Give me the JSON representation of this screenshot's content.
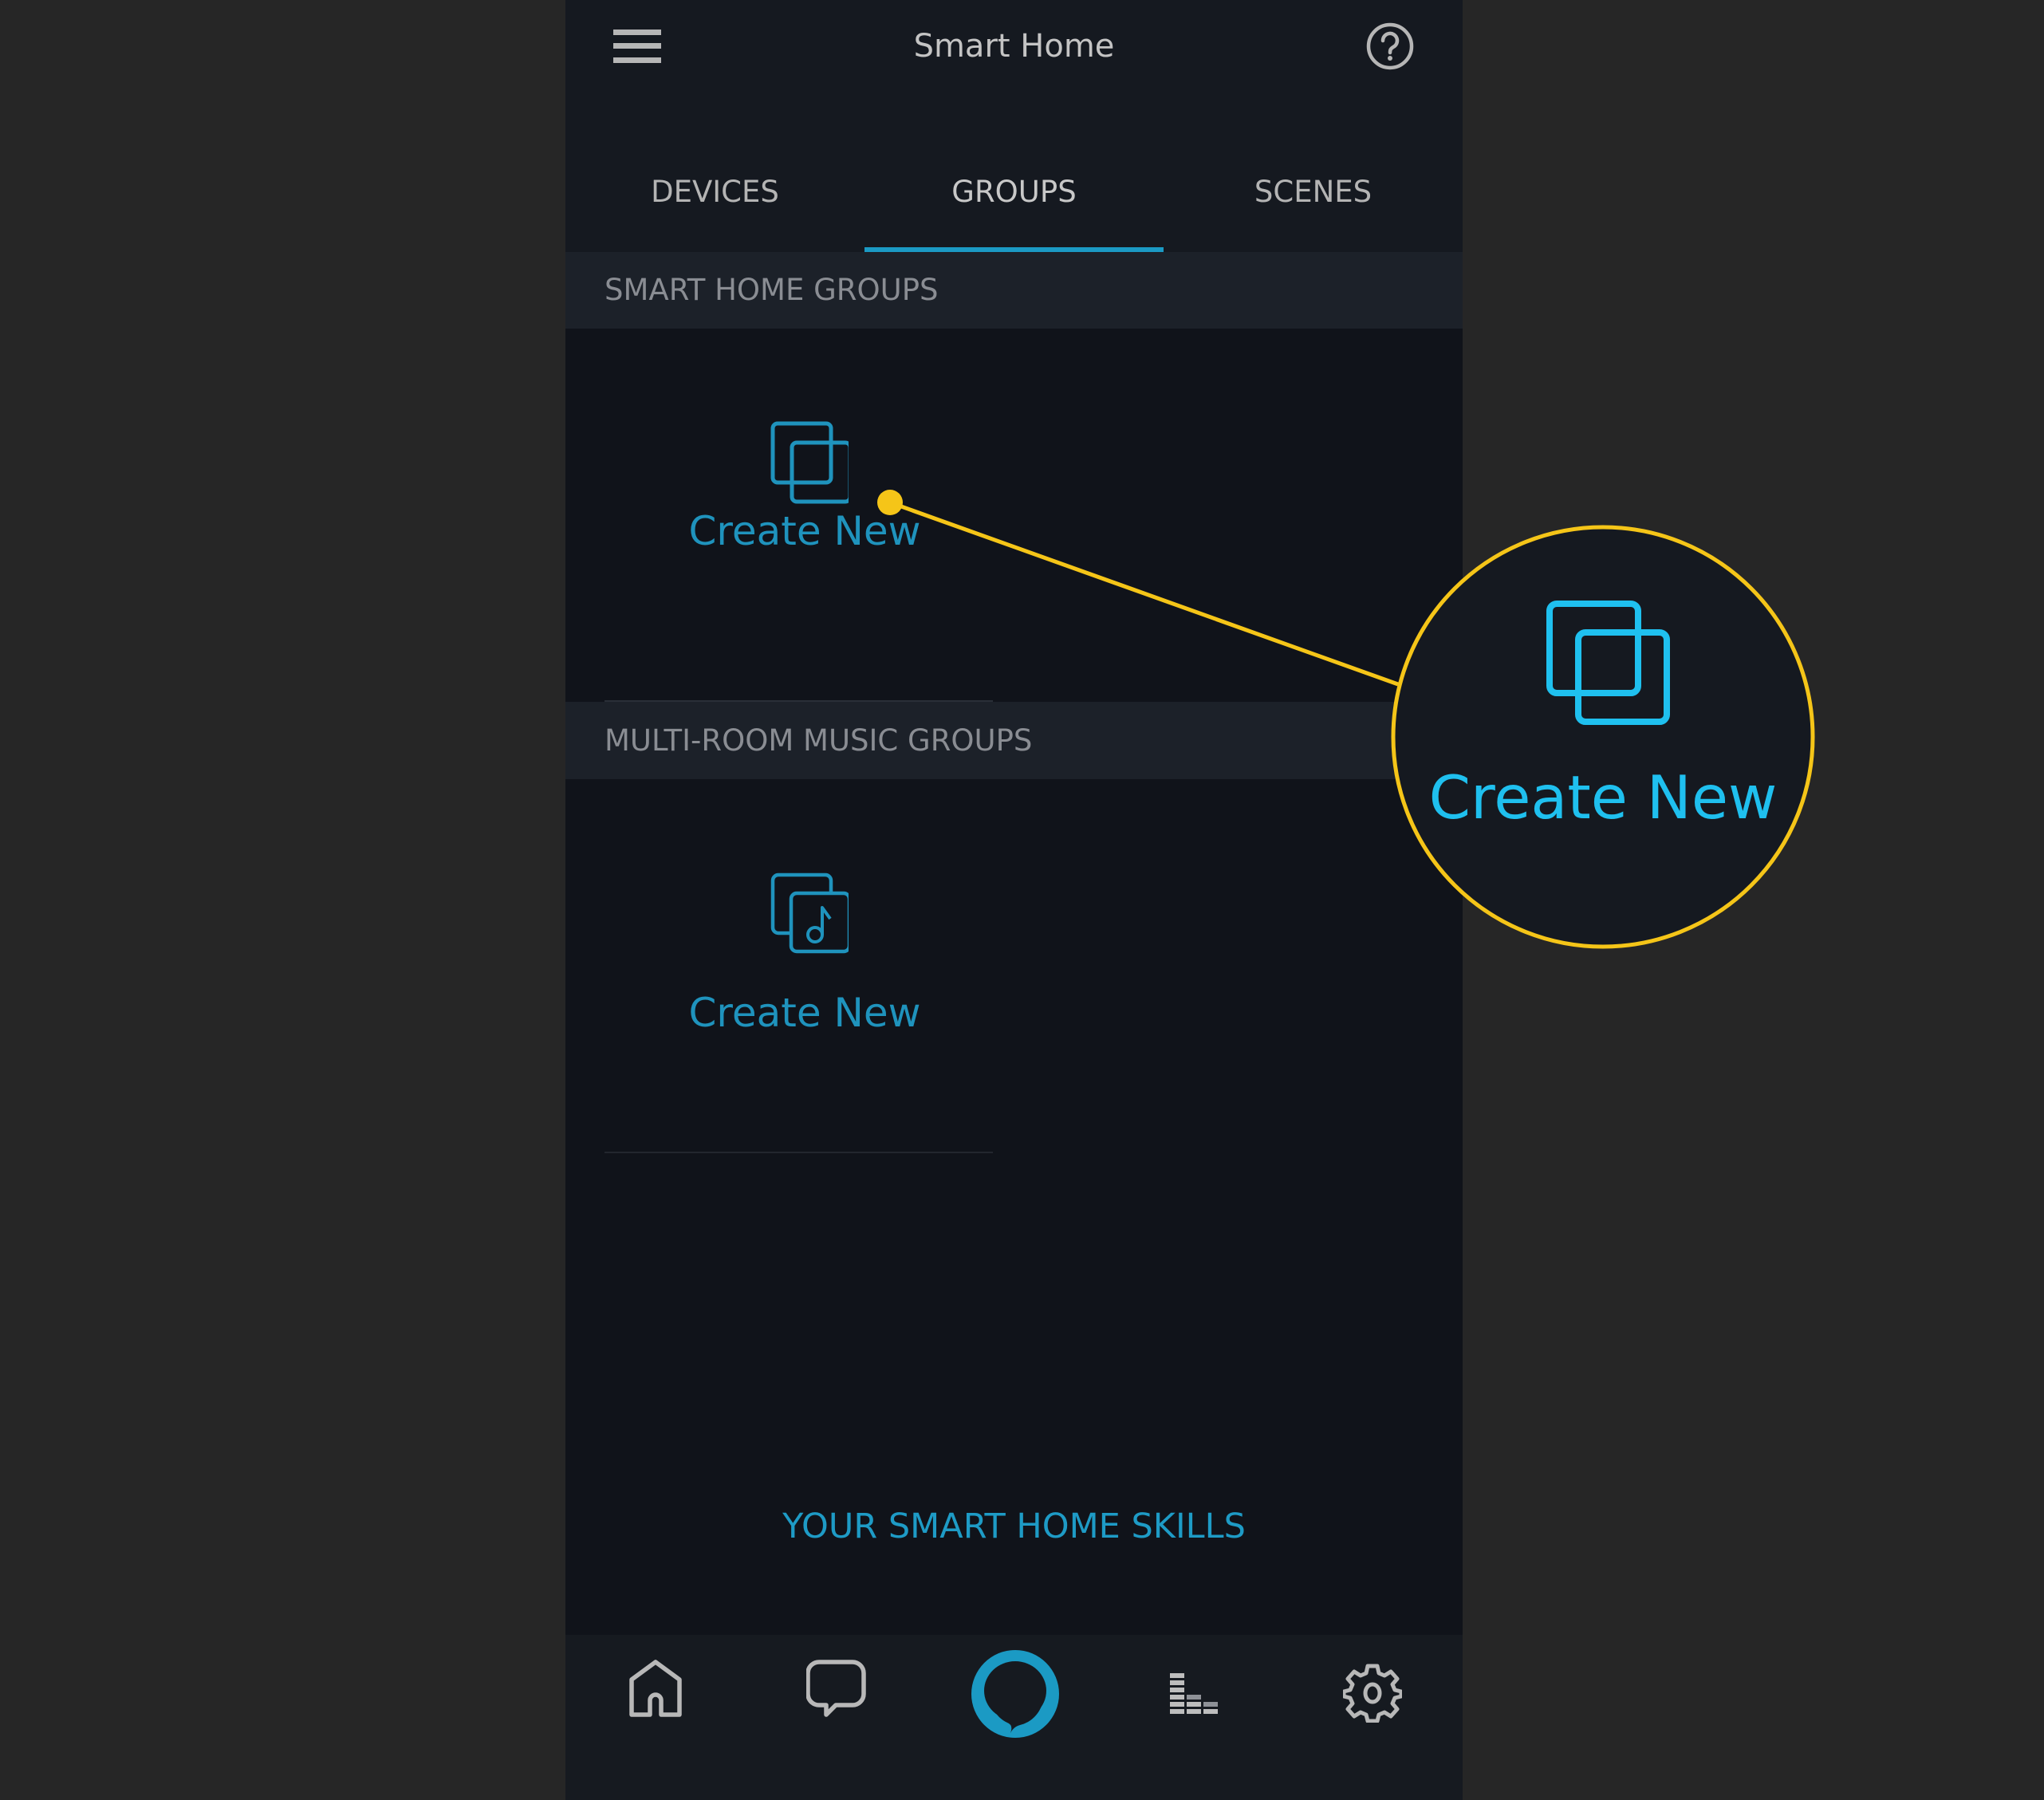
{
  "header": {
    "title": "Smart Home",
    "menu_icon": "hamburger-menu-icon",
    "help_icon": "help-circle-icon"
  },
  "tabs": [
    {
      "label": "DEVICES",
      "active": false
    },
    {
      "label": "GROUPS",
      "active": true
    },
    {
      "label": "SCENES",
      "active": false
    }
  ],
  "sections": {
    "smart_home_groups": {
      "title": "SMART HOME GROUPS",
      "create_label": "Create New",
      "icon": "stacked-squares-icon"
    },
    "multi_room_music_groups": {
      "title": "MULTI-ROOM MUSIC GROUPS",
      "create_label": "Create New",
      "icon": "stacked-squares-music-note-icon"
    }
  },
  "skills_link": "YOUR SMART HOME SKILLS",
  "bottom_nav": [
    {
      "name": "home",
      "icon": "home-icon"
    },
    {
      "name": "communicate",
      "icon": "chat-bubble-icon"
    },
    {
      "name": "alexa",
      "icon": "alexa-ring-icon"
    },
    {
      "name": "play",
      "icon": "equalizer-bars-icon"
    },
    {
      "name": "devices",
      "icon": "gear-icon"
    }
  ],
  "callout": {
    "magnified_label": "Create New",
    "highlight_color": "#f5c518"
  },
  "colors": {
    "accent": "#1b9ac4",
    "accent_bright": "#1fc0ef",
    "background_outer": "#262626",
    "background_app": "#10131a",
    "section_band": "#1c2129",
    "text_muted": "#8a8d93"
  }
}
